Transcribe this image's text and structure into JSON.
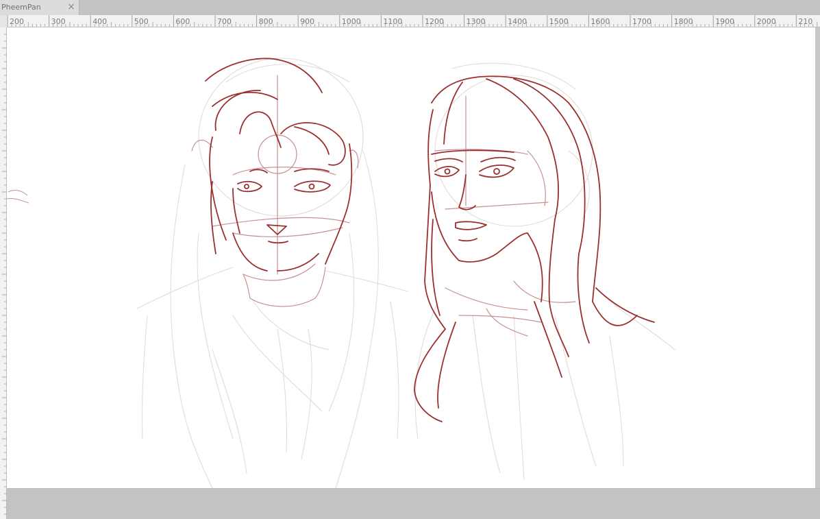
{
  "tab": {
    "title": "PheemPan",
    "close_symbol": "×"
  },
  "ruler": {
    "labels": [
      "200",
      "300",
      "400",
      "500",
      "600",
      "700",
      "800",
      "900",
      "1000",
      "1100",
      "1200",
      "1300",
      "1400",
      "1500",
      "1600",
      "1700",
      "1800",
      "1900",
      "2000",
      "210"
    ]
  },
  "colors": {
    "sketch_dark": "#9b2f2f",
    "sketch_light": "#d9b8b8",
    "sketch_faint": "#e4dede",
    "canvas": "#ffffff",
    "workspace": "#c3c3c3"
  },
  "icons": {
    "tab_close": "close-icon"
  }
}
